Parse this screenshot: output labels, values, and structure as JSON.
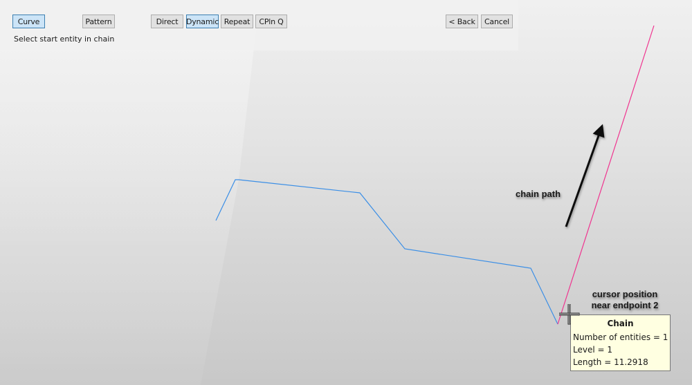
{
  "toolbar": {
    "buttons": {
      "curve": {
        "label": "Curve",
        "active": true
      },
      "pattern": {
        "label": "Pattern",
        "active": false
      },
      "direct": {
        "label": "Direct",
        "active": false
      },
      "dynamic": {
        "label": "Dynamic",
        "active": true
      },
      "repeat": {
        "label": "Repeat",
        "active": false
      },
      "cplnq": {
        "label": "CPln Q",
        "active": false
      },
      "back": {
        "label": "< Back",
        "active": false
      },
      "cancel": {
        "label": "Cancel",
        "active": false
      }
    },
    "prompt": "Select start entity in chain"
  },
  "colors": {
    "chain_curve": "#3a8ee6",
    "selected_segment": "#f0338f",
    "active_button_fill": "#cce4f7",
    "active_button_border": "#3c7fb1",
    "tooltip_fill": "#ffffe1"
  },
  "annotations": {
    "chain_path": "chain path",
    "cursor_line1": "cursor position",
    "cursor_line2": "near endpoint 2"
  },
  "tooltip": {
    "title": "Chain",
    "lines": [
      "Number of entities = 1",
      "Level = 1",
      "Length = 11.2918"
    ]
  },
  "icons": {
    "cursor": "crosshair-cursor-icon",
    "arrow": "direction-arrow-icon"
  }
}
